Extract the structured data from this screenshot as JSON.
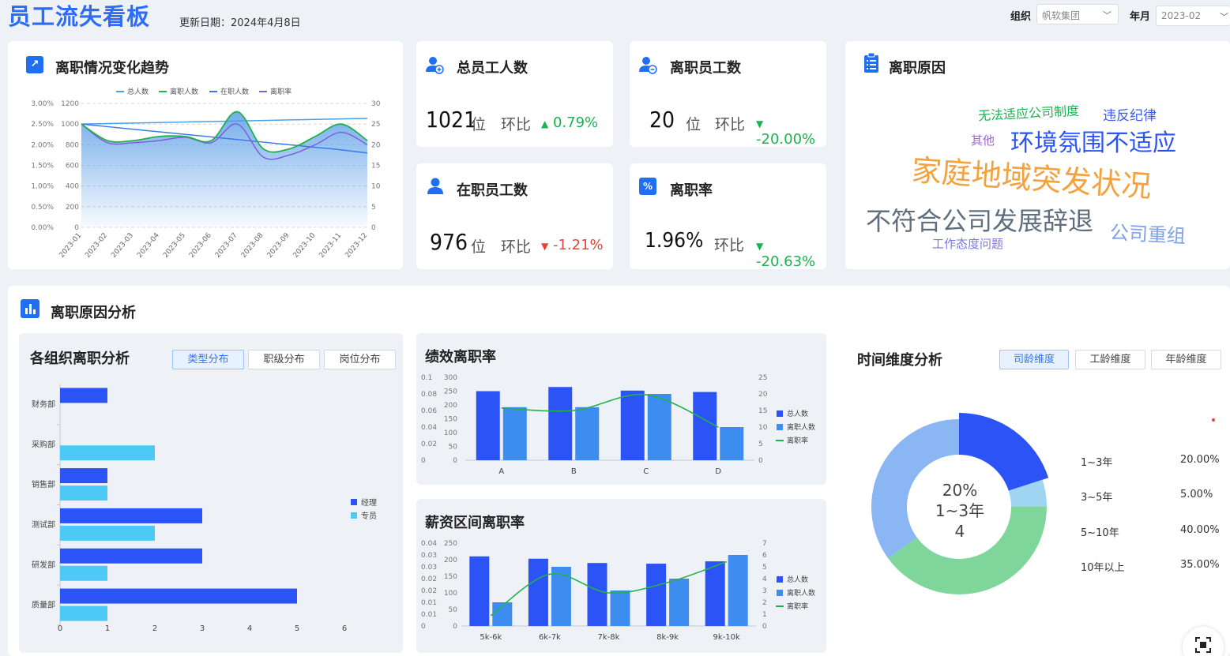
{
  "header": {
    "title": "员工流失看板",
    "update_label": "更新日期：2024年4月8日",
    "org_label": "组织",
    "org_value": "帆软集团",
    "month_label": "年月",
    "month_value": "2023-02"
  },
  "trend": {
    "title": "离职情况变化趋势",
    "chart_data": {
      "type": "line",
      "legend": [
        "总人数",
        "离职人数",
        "在职人数",
        "离职率"
      ],
      "x": [
        "2023-01",
        "2023-02",
        "2023-03",
        "2023-04",
        "2023-05",
        "2023-06",
        "2023-07",
        "2023-08",
        "2023-09",
        "2023-10",
        "2023-11",
        "2023-12"
      ],
      "left_ticks_pct": [
        "3.00%",
        "2.50%",
        "2.00%",
        "1.50%",
        "1.00%",
        "0.50%",
        "0.00%"
      ],
      "left_ticks": [
        "1200",
        "1000",
        "800",
        "600",
        "400",
        "200",
        "0"
      ],
      "right_ticks": [
        "30",
        "25",
        "20",
        "15",
        "10",
        "5",
        "0"
      ],
      "series": [
        {
          "name": "总人数",
          "values": [
            1000,
            1005,
            1010,
            1015,
            1020,
            1025,
            1030,
            1035,
            1040,
            1045,
            1050,
            1055
          ]
        },
        {
          "name": "离职人数",
          "values": [
            25,
            21,
            21,
            22,
            22,
            21,
            28,
            19,
            19,
            22,
            25,
            21
          ]
        },
        {
          "name": "在职人数",
          "values": [
            1000,
            975,
            950,
            925,
            900,
            875,
            850,
            825,
            800,
            775,
            750,
            720
          ]
        },
        {
          "name": "离职率",
          "values": [
            2.5,
            2.05,
            2.05,
            2.1,
            2.18,
            2.05,
            2.5,
            1.7,
            1.75,
            2.0,
            2.3,
            2.0
          ]
        }
      ]
    }
  },
  "kpi": {
    "total": {
      "title": "总员工人数",
      "value": "1021",
      "unit": "位",
      "hb": "环比",
      "change": "0.79%"
    },
    "leave": {
      "title": "离职员工数",
      "value": "20",
      "unit": "位",
      "hb": "环比",
      "change": "-20.00%"
    },
    "active": {
      "title": "在职员工数",
      "value": "976",
      "unit": "位",
      "hb": "环比",
      "change": "-1.21%"
    },
    "rate": {
      "title": "离职率",
      "value": "1.96%",
      "hb": "环比",
      "change": "-20.63%"
    }
  },
  "reasons": {
    "title": "离职原因",
    "words": [
      "无法适应公司制度",
      "违反纪律",
      "其他",
      "环境氛围不适应",
      "家庭地域突发状况",
      "不符合公司发展辞退",
      "公司重组",
      "工作态度问题"
    ]
  },
  "analysis": {
    "title": "离职原因分析"
  },
  "org_analysis": {
    "title": "各组织离职分析",
    "tabs": [
      "类型分布",
      "职级分布",
      "岗位分布"
    ],
    "chart_data": {
      "type": "bar",
      "categories": [
        "财务部",
        "采购部",
        "销售部",
        "测试部",
        "研发部",
        "质量部"
      ],
      "series": [
        {
          "name": "经理",
          "values": [
            1,
            0,
            1,
            3,
            3,
            5
          ]
        },
        {
          "name": "专员",
          "values": [
            0,
            2,
            1,
            2,
            1,
            1
          ]
        }
      ],
      "x_ticks": [
        "0",
        "1",
        "2",
        "3",
        "4",
        "5",
        "6"
      ]
    }
  },
  "perf": {
    "title": "绩效离职率",
    "chart_data": {
      "type": "bar",
      "categories": [
        "A",
        "B",
        "C",
        "D"
      ],
      "left_ticks_a": [
        "0.1",
        "0.08",
        "0.06",
        "0.04",
        "0.02",
        "0"
      ],
      "left_ticks_b": [
        "300",
        "250",
        "200",
        "150",
        "100",
        "50",
        "0"
      ],
      "right_ticks": [
        "25",
        "20",
        "15",
        "10",
        "5",
        "0"
      ],
      "series": [
        {
          "name": "总人数",
          "values": [
            250,
            265,
            252,
            247
          ]
        },
        {
          "name": "离职人数",
          "values": [
            16,
            16,
            20,
            10
          ]
        },
        {
          "name": "离职率",
          "values": [
            0.063,
            0.06,
            0.079,
            0.04
          ]
        }
      ],
      "legend": [
        "总人数",
        "离职人数",
        "离职率"
      ]
    }
  },
  "salary": {
    "title": "薪资区间离职率",
    "chart_data": {
      "type": "bar",
      "categories": [
        "5k-6k",
        "6k-7k",
        "7k-8k",
        "8k-9k",
        "9k-10k"
      ],
      "left_ticks_a": [
        "0.04",
        "0.03",
        "0.03",
        "0.02",
        "0.02",
        "0.01",
        "0.01",
        "0"
      ],
      "left_ticks_b": [
        "250",
        "200",
        "150",
        "100",
        "50",
        "0"
      ],
      "right_ticks": [
        "7",
        "6",
        "5",
        "4",
        "3",
        "2",
        "1",
        "0"
      ],
      "series": [
        {
          "name": "总人数",
          "values": [
            210,
            203,
            190,
            188,
            195
          ]
        },
        {
          "name": "离职人数",
          "values": [
            2,
            5,
            3,
            4,
            6
          ]
        },
        {
          "name": "离职率",
          "values": [
            0.005,
            0.025,
            0.016,
            0.021,
            0.031
          ]
        }
      ],
      "legend": [
        "总人数",
        "离职人数",
        "离职率"
      ]
    }
  },
  "time": {
    "title": "时间维度分析",
    "tabs": [
      "司龄维度",
      "工龄维度",
      "年龄维度"
    ],
    "center": {
      "pct": "20%",
      "label": "1~3年",
      "count": "4"
    },
    "chart_data": {
      "type": "pie",
      "categories": [
        "1~3年",
        "3~5年",
        "5~10年",
        "10年以上"
      ],
      "values": [
        20,
        5,
        40,
        35
      ],
      "labels_pct": [
        "20.00%",
        "5.00%",
        "40.00%",
        "35.00%"
      ]
    },
    "colors": [
      "#2b53f5",
      "#9fd4f2",
      "#7ed69b",
      "#8ab7f4"
    ]
  }
}
